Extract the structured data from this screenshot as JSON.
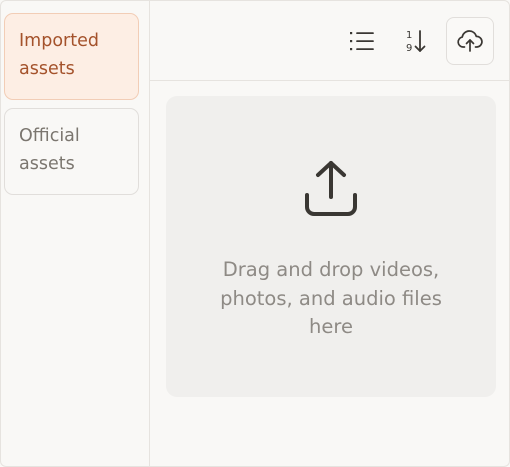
{
  "sidebar": {
    "tabs": [
      {
        "label": "Imported assets",
        "active": true
      },
      {
        "label": "Official assets",
        "active": false
      }
    ]
  },
  "toolbar": {
    "buttons": [
      {
        "icon": "list-icon"
      },
      {
        "icon": "sort-numeric-icon"
      },
      {
        "icon": "cloud-upload-icon"
      }
    ]
  },
  "dropzone": {
    "icon": "upload-icon",
    "text": "Drag and drop videos, photos, and audio files here"
  },
  "colors": {
    "accent_text": "#a4522b",
    "accent_bg": "#fdeee4",
    "muted_text": "#8e8a85"
  }
}
